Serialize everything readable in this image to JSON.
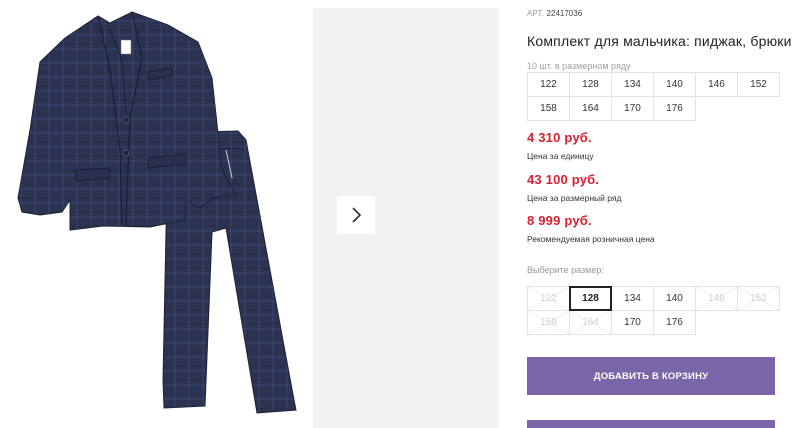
{
  "product": {
    "article_label": "АРТ.",
    "article_value": "22417036",
    "title": "Комплект для мальчика: пиджак, брюки",
    "pack_note": "10 шт. в размерном ряду",
    "pack_sizes": [
      "122",
      "128",
      "134",
      "140",
      "146",
      "152",
      "158",
      "164",
      "170",
      "176"
    ]
  },
  "prices": [
    {
      "value": "4 310 руб.",
      "label": "Цена за единицу"
    },
    {
      "value": "43 100 руб.",
      "label": "Цена за размерный ряд"
    },
    {
      "value": "8 999 руб.",
      "label": "Рекомендуемая розничная цена"
    }
  ],
  "size_picker": {
    "label": "Выберите размер:",
    "sizes": [
      {
        "label": "122",
        "state": "disabled"
      },
      {
        "label": "128",
        "state": "selected"
      },
      {
        "label": "134",
        "state": "available"
      },
      {
        "label": "140",
        "state": "available"
      },
      {
        "label": "146",
        "state": "disabled"
      },
      {
        "label": "152",
        "state": "disabled"
      },
      {
        "label": "158",
        "state": "disabled"
      },
      {
        "label": "164",
        "state": "disabled"
      },
      {
        "label": "170",
        "state": "available"
      },
      {
        "label": "176",
        "state": "available"
      }
    ]
  },
  "buttons": {
    "add_to_cart": "ДОБАВИТЬ В КОРЗИНУ"
  },
  "gallery": {
    "next_icon": "chevron-right-icon",
    "garment_color": "#2c3350",
    "thumb_bg": "#f2f2f2"
  },
  "colors": {
    "price": "#d8202f",
    "accent": "#7a65a8"
  }
}
